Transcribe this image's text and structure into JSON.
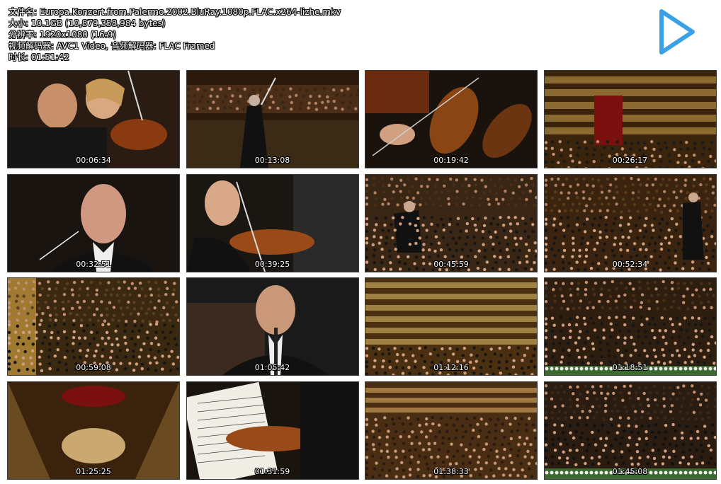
{
  "info": {
    "filename": "文件名: Europa.Konzert.from.Palermo.2002.BluRay.1080p.FLAC.x264-lizhe.mkv",
    "size": "大小: 10.1GB (10,879,358,984 bytes)",
    "resolution": "分辨率: 1920x1080 (16:9)",
    "codecs": "视频解码器: AVC1 Video, 音频解码器: FLAC Framed",
    "duration": "时长: 01:51:42"
  },
  "colors": {
    "play_icon": "#3aa0e8",
    "thumb_border": "#3a3a3a"
  },
  "icons": {
    "play": "play-icon"
  },
  "thumbnails": [
    {
      "time": "00:06:34",
      "scene": "violinists-closeup"
    },
    {
      "time": "00:13:08",
      "scene": "conductor-wide"
    },
    {
      "time": "00:19:42",
      "scene": "violins-closeup"
    },
    {
      "time": "00:26:17",
      "scene": "theater-wide"
    },
    {
      "time": "00:32:51",
      "scene": "conductor-closeup"
    },
    {
      "time": "00:39:25",
      "scene": "violinist-closeup"
    },
    {
      "time": "00:45:59",
      "scene": "conductor-orchestra"
    },
    {
      "time": "00:52:34",
      "scene": "orchestra-conductor-right"
    },
    {
      "time": "00:59:08",
      "scene": "theater-orchestra-high"
    },
    {
      "time": "01:05:42",
      "scene": "clarinet-player"
    },
    {
      "time": "01:12:16",
      "scene": "theater-balconies"
    },
    {
      "time": "01:18:51",
      "scene": "orchestra-flowers"
    },
    {
      "time": "01:25:25",
      "scene": "theater-stage-high"
    },
    {
      "time": "01:31:59",
      "scene": "violin-score"
    },
    {
      "time": "01:38:33",
      "scene": "audience-orchestra"
    },
    {
      "time": "01:45:08",
      "scene": "orchestra-flowers-front"
    }
  ]
}
